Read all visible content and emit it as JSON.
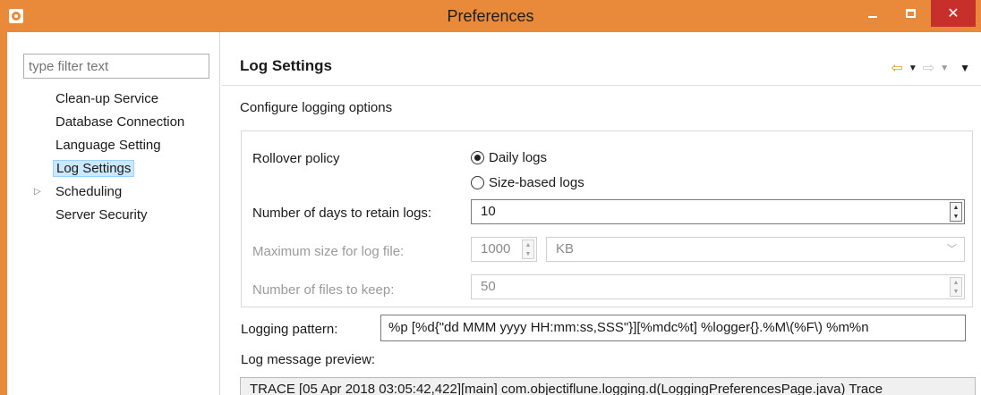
{
  "window": {
    "title": "Preferences",
    "icon": "app-gear-icon",
    "close_glyph": "✕",
    "accent_color": "#e88a39",
    "close_color": "#c7302a"
  },
  "filter": {
    "placeholder": "type filter text"
  },
  "tree": {
    "items": [
      {
        "label": "Clean-up Service"
      },
      {
        "label": "Database Connection"
      },
      {
        "label": "Language Setting"
      },
      {
        "label": "Log Settings",
        "selected": true
      },
      {
        "label": "Scheduling",
        "expandable": true
      },
      {
        "label": "Server Security"
      }
    ]
  },
  "page": {
    "title": "Log Settings",
    "description": "Configure logging options",
    "nav": {
      "back_glyph": "⇦",
      "forward_glyph": "⇨",
      "dropdown_glyph": "▼"
    }
  },
  "form": {
    "rollover_label": "Rollover policy",
    "rollover_options": [
      {
        "label": "Daily logs",
        "checked": true
      },
      {
        "label": "Size-based logs",
        "checked": false
      }
    ],
    "days_label": "Number of days to retain logs:",
    "days_value": "10",
    "max_size_label": "Maximum size for log file:",
    "max_size_value": "1000",
    "max_size_unit": "KB",
    "files_label": "Number of files to keep:",
    "files_value": "50",
    "pattern_label": "Logging pattern:",
    "pattern_value": "%p [%d{\"dd MMM yyyy HH:mm:ss,SSS\"}][%mdc%t] %logger{}.%M\\(%F\\) %m%n",
    "preview_label": "Log message preview:",
    "preview_value": "TRACE [05 Apr 2018 03:05:42,422][main] com.objectiflune.logging.d(LoggingPreferencesPage.java) Trace"
  }
}
